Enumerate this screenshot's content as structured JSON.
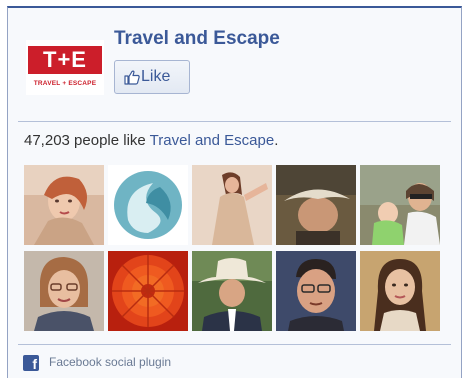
{
  "page": {
    "name": "Travel and Escape",
    "logo_main": "T+E",
    "logo_sub": "TRAVEL + ESCAPE"
  },
  "like_button": {
    "label": "Like"
  },
  "fans": {
    "count_text": "47,203 people like ",
    "page_link": "Travel and Escape",
    "suffix": "."
  },
  "face_icons": [
    "avatar-vintage-woman",
    "avatar-logo-swirl",
    "avatar-woman-dress",
    "avatar-man-hat",
    "avatar-family-child",
    "avatar-woman-glasses",
    "avatar-red-flower",
    "avatar-man-cowboy-hat",
    "avatar-man-glasses",
    "avatar-young-woman"
  ],
  "footer": {
    "label": "Facebook social plugin",
    "icon": "facebook-icon"
  },
  "colors": {
    "brand": "#3b5998",
    "logo_red": "#cc1e2a"
  }
}
